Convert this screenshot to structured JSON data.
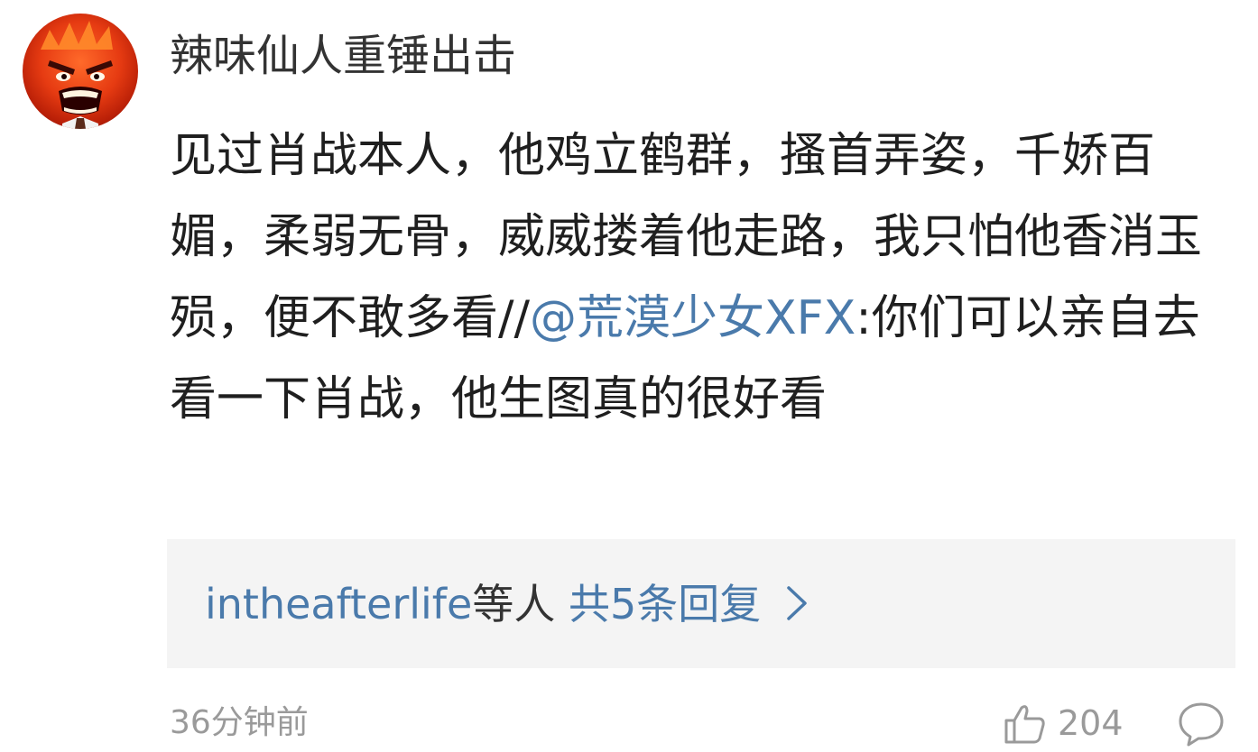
{
  "comment": {
    "username": "辣味仙人重锤出击",
    "text_part1": "见过肖战本人，他鸡立鹤群，搔首弄姿，千娇百媚，柔弱无骨，威威搂着他走路，我只怕他香消玉殒，便不敢多看//",
    "mention": "@荒漠少女XFX",
    "text_part2": ":你们可以亲自去看一下肖战，他生图真的很好看",
    "time": "36分钟前",
    "like_count": "204"
  },
  "replies": {
    "user": "intheafterlife",
    "suffix": "等人",
    "total": "共5条回复"
  },
  "icons": {
    "avatar": "angry-cartoon-avatar",
    "like": "thumbs-up-icon",
    "comment": "speech-bubble-icon",
    "chevron": "chevron-right-icon"
  },
  "colors": {
    "link": "#4a7aab",
    "text": "#1f1f1f",
    "muted": "#9a9a9a",
    "reply_bg": "#f4f4f4"
  }
}
